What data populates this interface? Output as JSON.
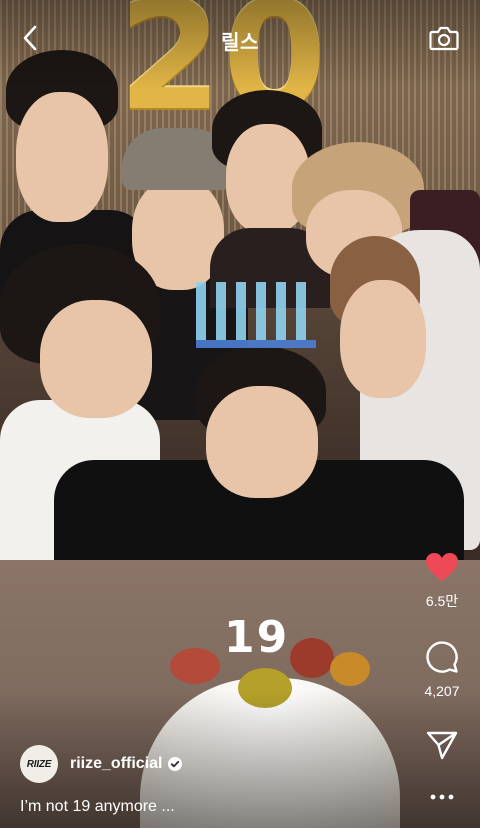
{
  "header": {
    "title": "릴스",
    "back_icon": "chevron-left-icon",
    "camera_icon": "camera-icon"
  },
  "video": {
    "balloon_text": "20",
    "candle_text": "19"
  },
  "actions": {
    "like_icon": "heart-icon",
    "like_color": "#ed4956",
    "like_count": "6.5만",
    "comment_icon": "comment-icon",
    "comment_count": "4,207",
    "share_icon": "send-icon",
    "more_icon": "more-icon"
  },
  "post": {
    "avatar_text": "RIIZE",
    "username": "riize_official",
    "verified_icon": "verified-badge-icon",
    "caption": "I’m not 19 anymore ..."
  }
}
